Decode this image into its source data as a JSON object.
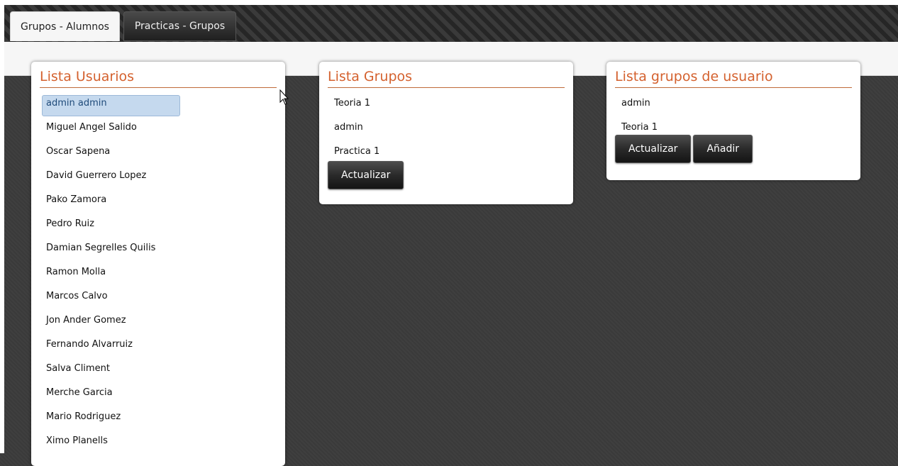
{
  "tabs": [
    {
      "label": "Grupos - Alumnos",
      "active": true
    },
    {
      "label": "Practicas - Grupos",
      "active": false
    }
  ],
  "panels": {
    "usuarios": {
      "title": "Lista Usuarios",
      "items": [
        "admin admin",
        "Miguel Angel Salido",
        "Oscar Sapena",
        "David Guerrero Lopez",
        "Pako Zamora",
        "Pedro Ruiz",
        "Damian Segrelles Quilis",
        "Ramon Molla",
        "Marcos Calvo",
        "Jon Ander Gomez",
        "Fernando Alvarruiz",
        "Salva Climent",
        "Merche Garcia",
        "Mario Rodriguez",
        "Ximo Planells"
      ],
      "selected_index": 0
    },
    "grupos": {
      "title": "Lista Grupos",
      "items": [
        "Teoria 1",
        "admin",
        "Practica 1"
      ],
      "button_actualizar": "Actualizar"
    },
    "grupos_usuario": {
      "title": "Lista grupos de usuario",
      "items": [
        "admin",
        "Teoria 1"
      ],
      "button_actualizar": "Actualizar",
      "button_anadir": "Añadir"
    }
  },
  "colors": {
    "accent": "#d4612e",
    "selected_bg": "#c5d9ee",
    "background": "#3c3c3c"
  }
}
